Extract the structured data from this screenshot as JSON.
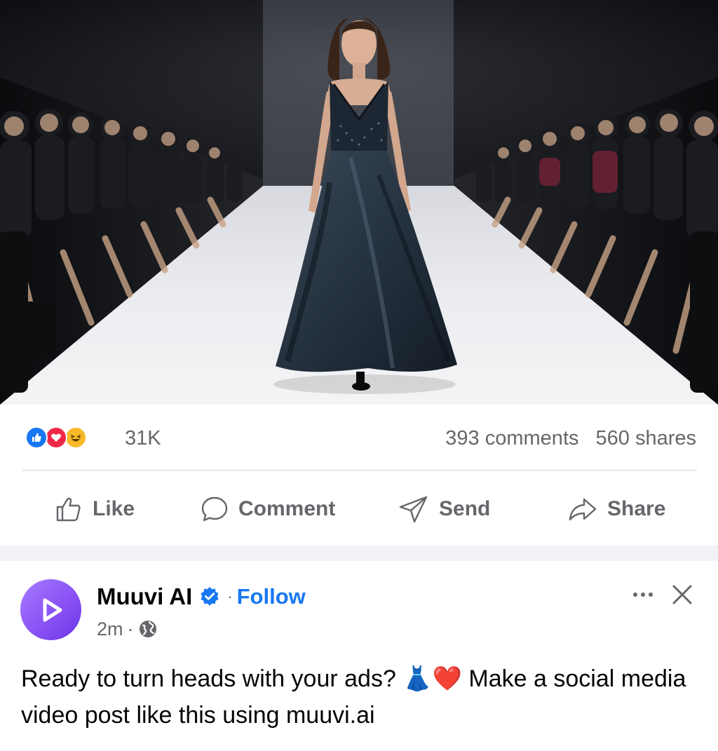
{
  "post": {
    "author": "Muuvi AI",
    "follow_label": "Follow",
    "separator": "·",
    "time": "2m",
    "caption": "Ready to turn heads with your ads? 👗❤️ Make a social media video post like this using muuvi.ai",
    "image_alt": "Model in a long navy satin gown walking a fashion runway between seated audience members"
  },
  "stats": {
    "reactions": [
      "like",
      "love",
      "haha"
    ],
    "reaction_count": "31K",
    "comments": "393 comments",
    "shares": "560 shares"
  },
  "actions": {
    "like": "Like",
    "comment": "Comment",
    "send": "Send",
    "share": "Share"
  },
  "icons": {
    "verified": "verified-badge-icon",
    "audience": "globe-icon",
    "more": "more-options-icon",
    "close": "close-icon",
    "avatar_logo": "play-icon"
  },
  "colors": {
    "brand_blue": "#1877f2",
    "muted_text": "#65676b",
    "love_red": "#f02849",
    "haha_yellow": "#f7b928",
    "avatar_purple": "#8a52f5"
  }
}
